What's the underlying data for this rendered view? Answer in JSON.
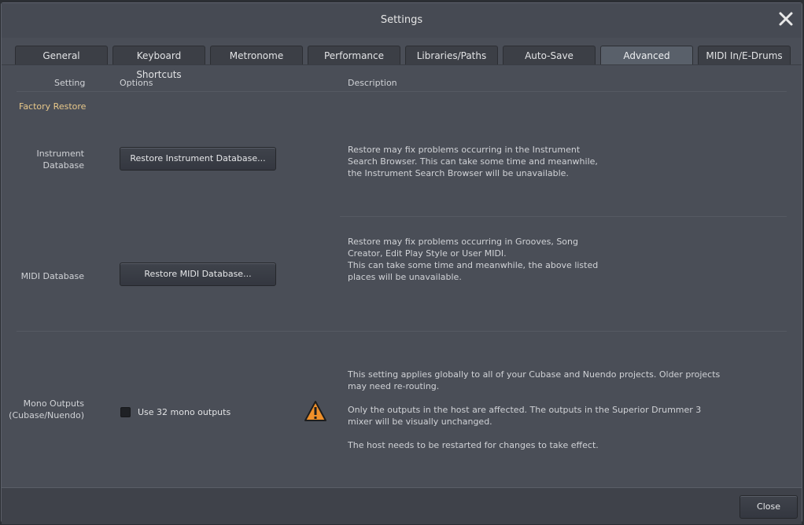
{
  "window": {
    "title": "Settings"
  },
  "tabs": [
    {
      "label": "General"
    },
    {
      "label": "Keyboard Shortcuts"
    },
    {
      "label": "Metronome"
    },
    {
      "label": "Performance"
    },
    {
      "label": "Libraries/Paths"
    },
    {
      "label": "Auto-Save"
    },
    {
      "label": "Advanced",
      "active": true
    },
    {
      "label": "MIDI In/E-Drums"
    }
  ],
  "columns": {
    "setting": "Setting",
    "options": "Options",
    "description": "Description"
  },
  "section_title": "Factory Restore",
  "instrument_db": {
    "label_line1": "Instrument",
    "label_line2": "Database",
    "button": "Restore Instrument Database...",
    "desc": [
      "Restore may fix problems occurring in the Instrument",
      "Search Browser. This can take some time and meanwhile,",
      "the Instrument Search Browser will be unavailable."
    ]
  },
  "midi_db": {
    "label": "MIDI Database",
    "button": "Restore MIDI Database...",
    "desc": [
      "Restore may fix problems occurring in Grooves, Song",
      "Creator, Edit Play Style or User MIDI.",
      "This can take some time and meanwhile, the above listed",
      "places will be unavailable."
    ]
  },
  "mono_outputs": {
    "label_line1": "Mono Outputs",
    "label_line2": "(Cubase/Nuendo)",
    "checkbox_label": "Use 32 mono outputs",
    "checked": false,
    "warning_icon": "warning-triangle-icon",
    "desc_p1": [
      "This setting applies globally to all of your Cubase and Nuendo projects. Older projects",
      "may need re-routing."
    ],
    "desc_p2": [
      "Only the outputs in the host are affected. The outputs in the Superior Drummer 3",
      "mixer will be visually unchanged."
    ],
    "desc_p3": "The host needs to be restarted for changes to take effect."
  },
  "footer": {
    "close_label": "Close"
  },
  "colors": {
    "accent": "#e8c88a",
    "warning": "#f0902a"
  }
}
